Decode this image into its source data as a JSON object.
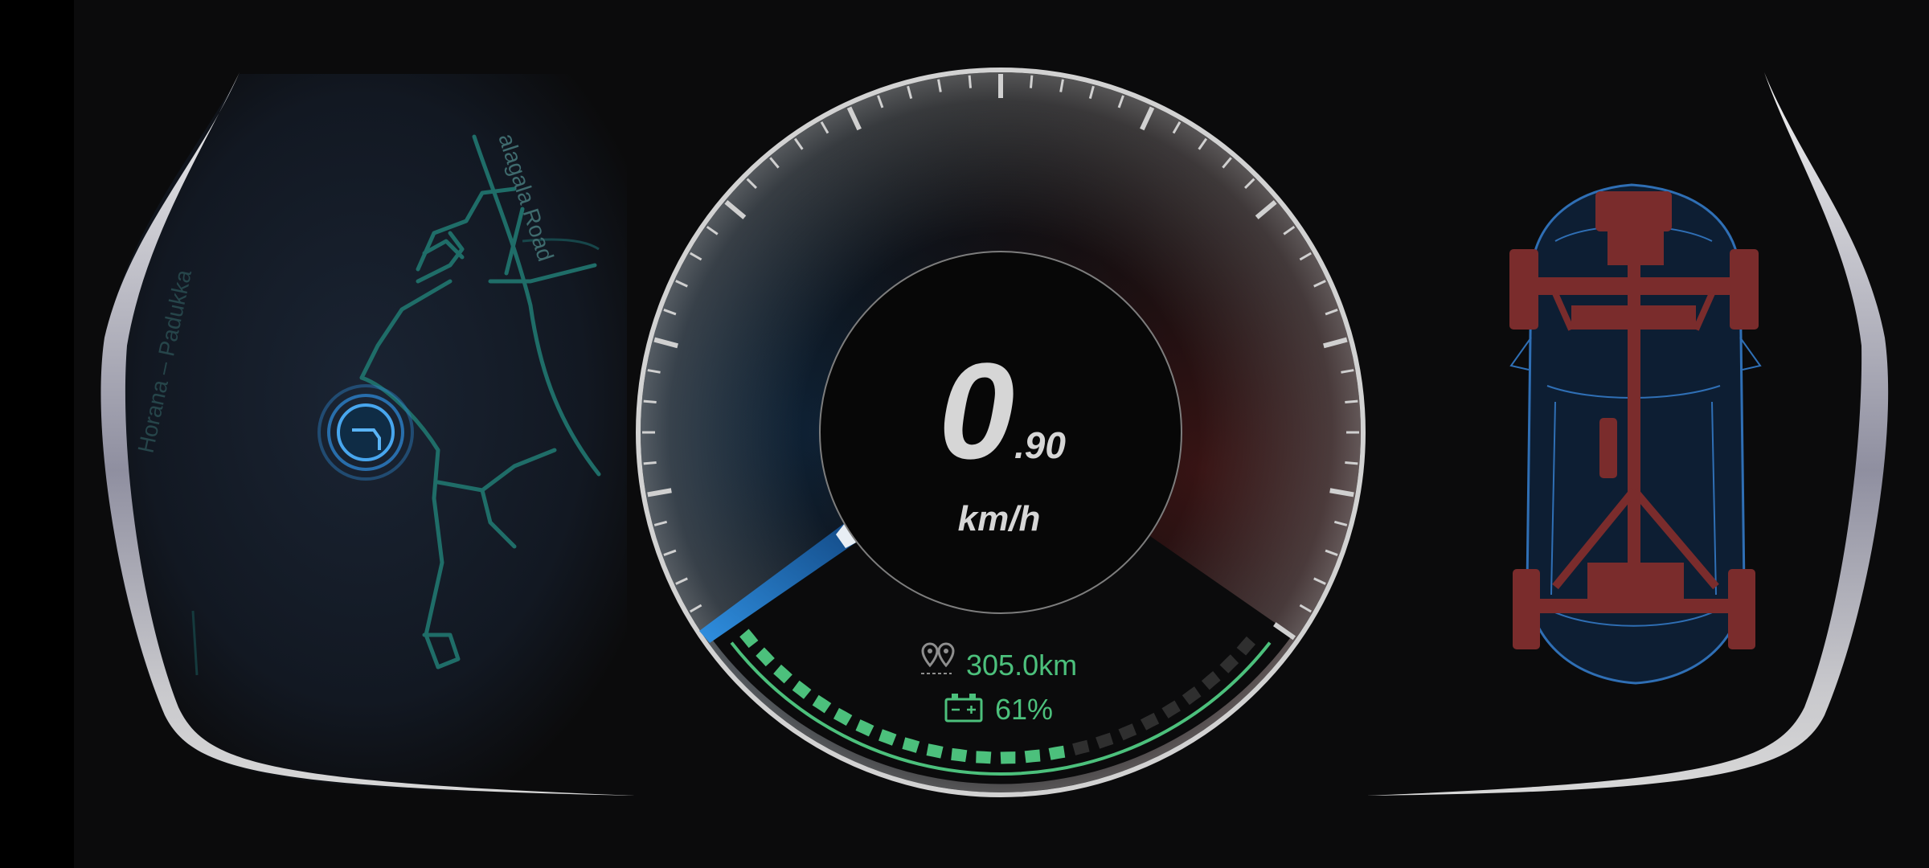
{
  "colors": {
    "screen_background": "#0b0b0c",
    "left_edge_bar": "#000000",
    "accent_blue": "#2f8fe0",
    "accent_green": "#4cc07c",
    "route_teal": "#1f6d68",
    "warm_red": "#8a2f2f",
    "text_light": "#d6d6d6"
  },
  "map": {
    "road_labels": [
      "Horana – Padukka",
      "alagala Road"
    ],
    "location_marker_icon": "current-location-icon"
  },
  "speedometer": {
    "speed_integer": "0",
    "speed_decimal": ".90",
    "unit": "km/h",
    "speed_fraction_of_scale": 0.0,
    "range_icon": "route-pins-icon",
    "range": "305.0km",
    "battery_icon": "battery-icon",
    "battery": "61%",
    "battery_level": 0.61
  },
  "vehicle": {
    "icon": "car-chassis-top-view-icon"
  }
}
